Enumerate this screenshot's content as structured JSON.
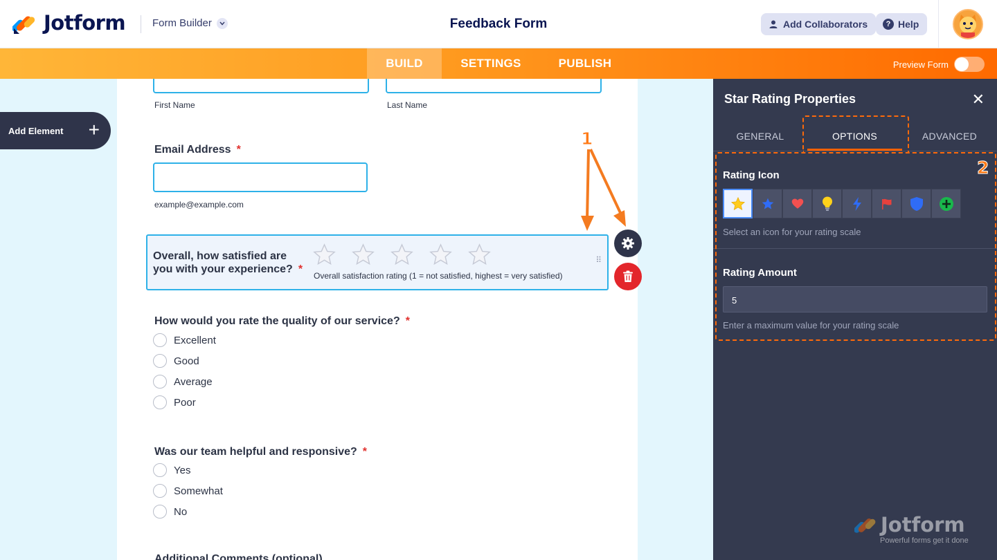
{
  "header": {
    "brand": "Jotform",
    "builder_switch": "Form Builder",
    "form_title": "Feedback Form",
    "add_collaborators": "Add Collaborators",
    "help": "Help"
  },
  "nav": {
    "tabs": [
      "BUILD",
      "SETTINGS",
      "PUBLISH"
    ],
    "active": "BUILD",
    "preview_label": "Preview Form",
    "preview_on": false
  },
  "sidebar": {
    "add_element": "Add Element"
  },
  "form": {
    "name_sublabels": [
      "First Name",
      "Last Name"
    ],
    "email": {
      "label": "Email Address",
      "required": "*",
      "sublabel": "example@example.com"
    },
    "rating": {
      "label": "Overall, how satisfied are you with your experience?",
      "required": "*",
      "sublabel": "Overall satisfaction rating (1 = not satisfied, highest = very satisfied)",
      "stars": 5
    },
    "q_quality": {
      "label": "How would you rate the quality of our service?",
      "required": "*",
      "options": [
        "Excellent",
        "Good",
        "Average",
        "Poor"
      ]
    },
    "q_team": {
      "label": "Was our team helpful and responsive?",
      "required": "*",
      "options": [
        "Yes",
        "Somewhat",
        "No"
      ]
    },
    "q_comments": {
      "label": "Additional Comments (optional)"
    }
  },
  "panel": {
    "title": "Star Rating Properties",
    "tabs": [
      "GENERAL",
      "OPTIONS",
      "ADVANCED"
    ],
    "active_tab": "OPTIONS",
    "rating_icon": {
      "label": "Rating Icon",
      "help": "Select an icon for your rating scale",
      "icons": [
        "star-yellow",
        "star-blue",
        "heart",
        "lightbulb",
        "lightning",
        "flag",
        "shield",
        "plus-circle"
      ],
      "selected": "star-yellow"
    },
    "rating_amount": {
      "label": "Rating Amount",
      "value": "5",
      "help": "Enter a maximum value for your rating scale"
    },
    "footer_brand": "Jotform",
    "footer_tagline": "Powerful forms get it done"
  },
  "annotations": [
    "1",
    "2"
  ],
  "colors": {
    "accent_orange": "#ff6100",
    "field_border": "#2eb1e8",
    "panel_bg": "#343a4f",
    "required": "#e1312e"
  }
}
